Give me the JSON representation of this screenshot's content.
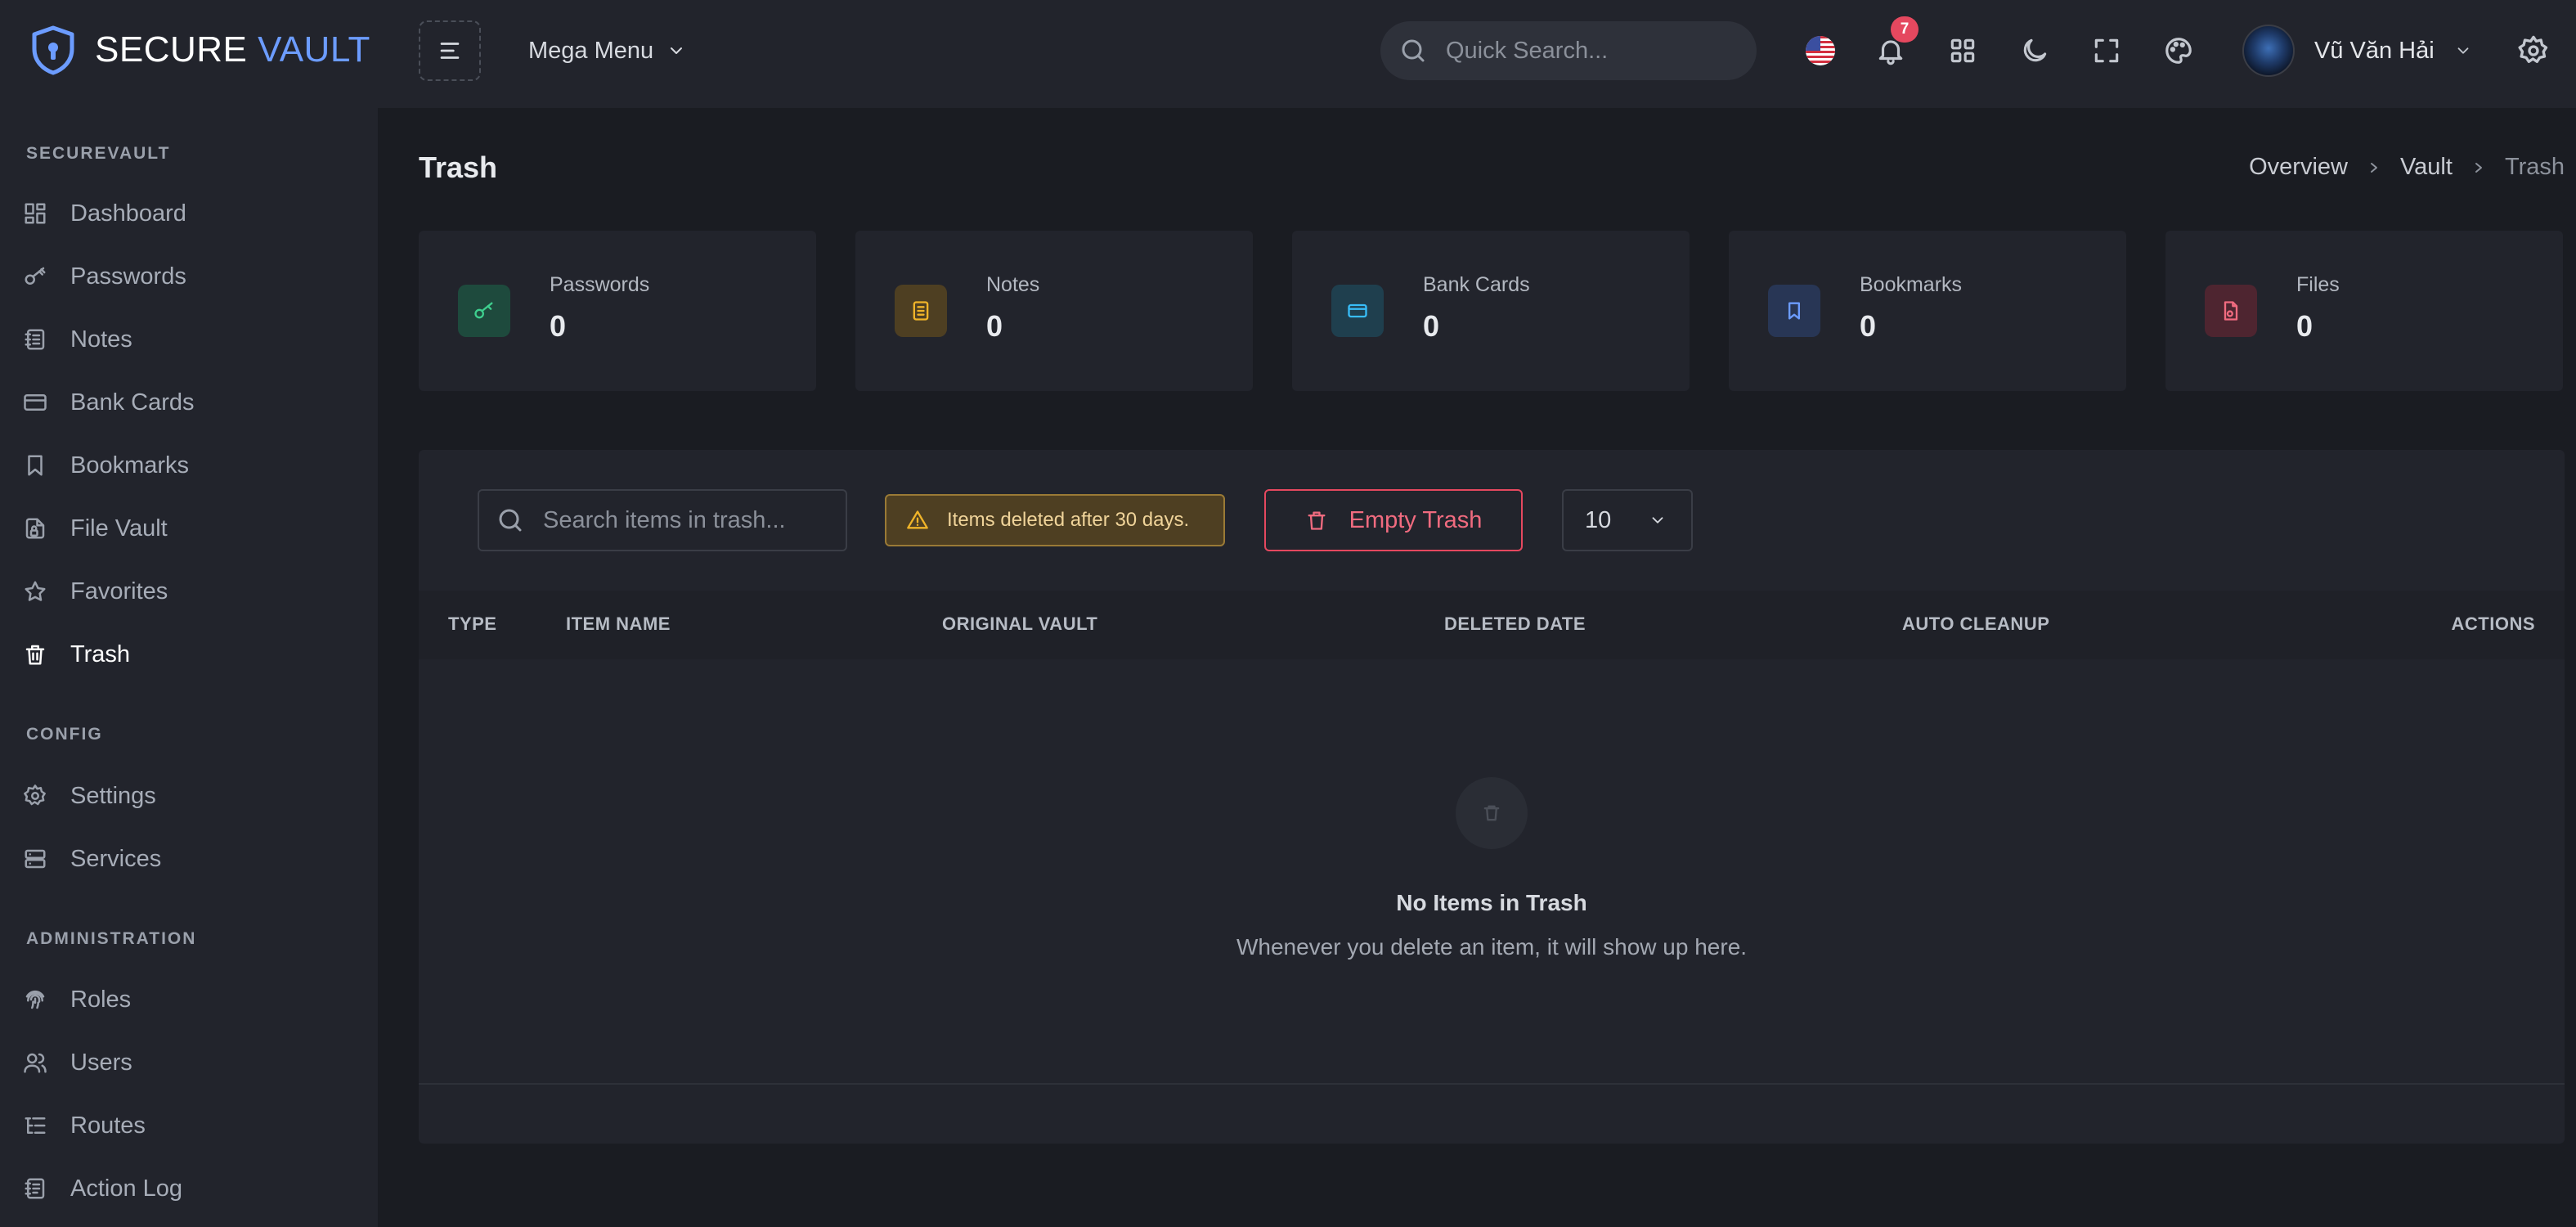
{
  "brand": {
    "name_part1": "SECURE",
    "name_part2": "VAULT"
  },
  "sidebar": {
    "sections": [
      {
        "title": "SECUREVAULT"
      },
      {
        "title": "CONFIG"
      },
      {
        "title": "ADMINISTRATION"
      }
    ],
    "items": [
      {
        "label": "Dashboard",
        "icon": "dashboard-icon"
      },
      {
        "label": "Passwords",
        "icon": "key-icon"
      },
      {
        "label": "Notes",
        "icon": "notes-icon"
      },
      {
        "label": "Bank Cards",
        "icon": "credit-card-icon"
      },
      {
        "label": "Bookmarks",
        "icon": "bookmark-icon"
      },
      {
        "label": "File Vault",
        "icon": "file-lock-icon"
      },
      {
        "label": "Favorites",
        "icon": "star-icon"
      },
      {
        "label": "Trash",
        "icon": "trash-icon",
        "active": true
      },
      {
        "label": "Settings",
        "icon": "gear-icon"
      },
      {
        "label": "Services",
        "icon": "server-icon"
      },
      {
        "label": "Roles",
        "icon": "fingerprint-icon"
      },
      {
        "label": "Users",
        "icon": "users-icon"
      },
      {
        "label": "Routes",
        "icon": "list-icon"
      },
      {
        "label": "Action Log",
        "icon": "log-icon"
      }
    ]
  },
  "header": {
    "mega_menu": "Mega Menu",
    "search_placeholder": "Quick Search...",
    "notification_count": "7",
    "user_name": "Vũ Văn Hải"
  },
  "page": {
    "title": "Trash",
    "breadcrumb": [
      "Overview",
      "Vault",
      "Trash"
    ]
  },
  "stats": [
    {
      "label": "Passwords",
      "value": "0",
      "color": "#3ecf8e"
    },
    {
      "label": "Notes",
      "value": "0",
      "color": "#f0b429"
    },
    {
      "label": "Bank Cards",
      "value": "0",
      "color": "#38bdf8"
    },
    {
      "label": "Bookmarks",
      "value": "0",
      "color": "#6c9cff"
    },
    {
      "label": "Files",
      "value": "0",
      "color": "#f06b7f"
    }
  ],
  "table": {
    "search_placeholder": "Search items in trash...",
    "notice": "Items deleted after 30 days.",
    "empty_button": "Empty Trash",
    "per_page": "10",
    "columns": [
      "TYPE",
      "ITEM NAME",
      "ORIGINAL VAULT",
      "DELETED DATE",
      "AUTO CLEANUP",
      "ACTIONS"
    ],
    "empty_title": "No Items in Trash",
    "empty_subtitle": "Whenever you delete an item, it will show up here."
  },
  "colors": {
    "accent": "#6c9cff",
    "danger": "#e5485f",
    "warning": "#f0b429"
  }
}
